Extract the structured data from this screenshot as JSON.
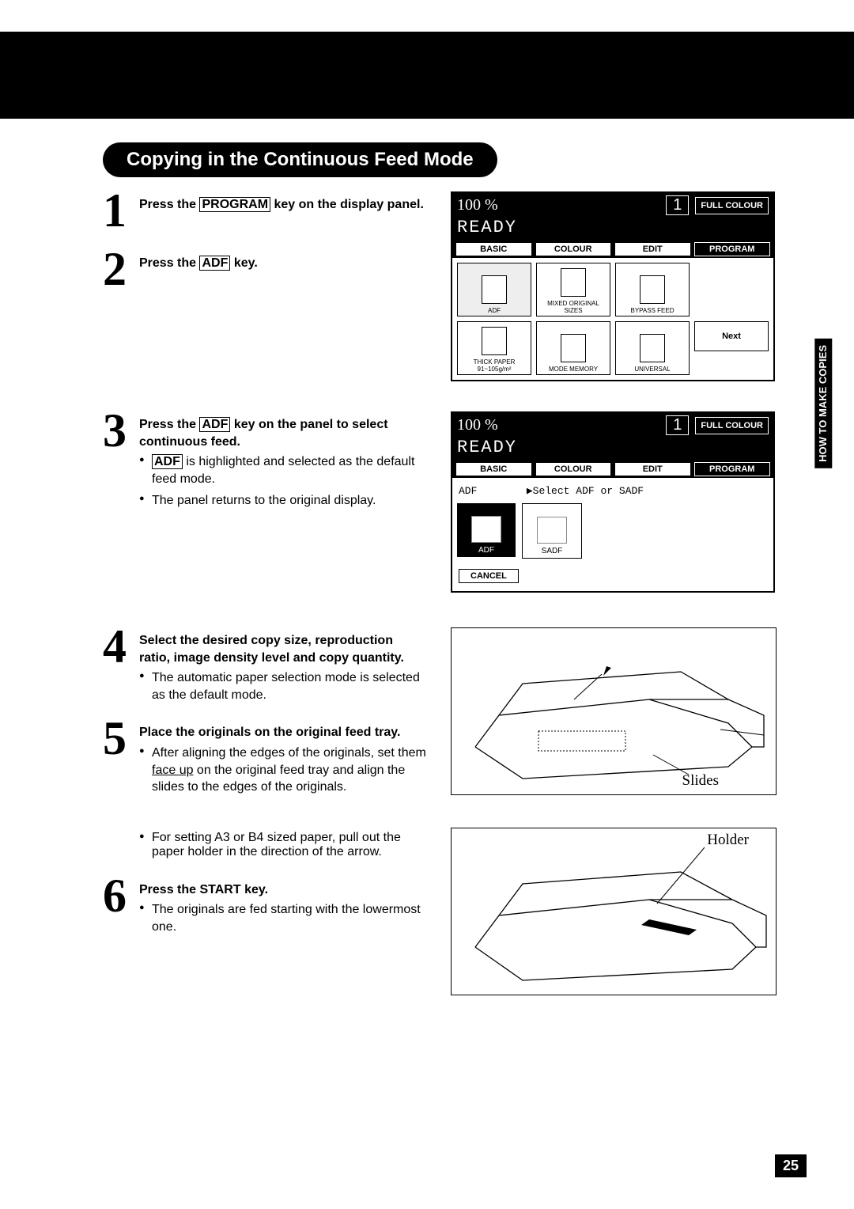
{
  "title": "Copying in the Continuous Feed Mode",
  "side_tab": "HOW TO MAKE COPIES",
  "page_number": "25",
  "keys": {
    "program": "PROGRAM",
    "adf": "ADF"
  },
  "steps": {
    "s1_a": "Press the ",
    "s1_b": " key on the display panel.",
    "s2_a": "Press the ",
    "s2_b": " key.",
    "s3_a": "Press the ",
    "s3_b": " key on the panel to select continuous feed.",
    "s3_bullets": [
      {
        "keyed": "ADF",
        "after": " is highlighted and selected as the default feed mode."
      },
      {
        "text": "The panel returns to the original display."
      }
    ],
    "s4_title": "Select the desired copy size, reproduction ratio, image density level and copy quantity.",
    "s4_b1": "The automatic paper selection mode is selected as the default mode.",
    "s5_title": "Place the originals on the original feed tray.",
    "s5_b1a": "After aligning the edges of the originals, set them ",
    "s5_b1_underline": "face up",
    "s5_b1b": " on the original feed tray and align the slides to the edges of the originals.",
    "s5_b2": "For setting A3 or B4 sized paper, pull out the paper holder in the direction of the arrow.",
    "s6_title": "Press the START key.",
    "s6_b1": "The originals are fed starting with the lowermost one."
  },
  "panel1": {
    "pct": "100 %",
    "count": "1",
    "mode": "FULL COLOUR",
    "ready": "READY",
    "tabs": {
      "basic": "BASIC",
      "colour": "COLOUR",
      "edit": "EDIT",
      "program": "PROGRAM"
    },
    "cells": {
      "adf": "ADF",
      "mixed": "MIXED ORIGINAL SIZES",
      "bypass": "BYPASS FEED",
      "thick": "THICK PAPER 91~105g/m²",
      "modemem": "MODE MEMORY",
      "universal": "UNIVERSAL",
      "next": "Next"
    }
  },
  "panel2": {
    "pct": "100 %",
    "count": "1",
    "mode": "FULL COLOUR",
    "ready": "READY",
    "tabs": {
      "basic": "BASIC",
      "colour": "COLOUR",
      "edit": "EDIT",
      "program": "PROGRAM"
    },
    "subline1": "ADF",
    "subline2": "▶Select ADF or SADF",
    "adf_btn": "ADF",
    "sadf_btn": "SADF",
    "cancel": "CANCEL"
  },
  "diagram1_label": "Slides",
  "diagram2_label": "Holder"
}
